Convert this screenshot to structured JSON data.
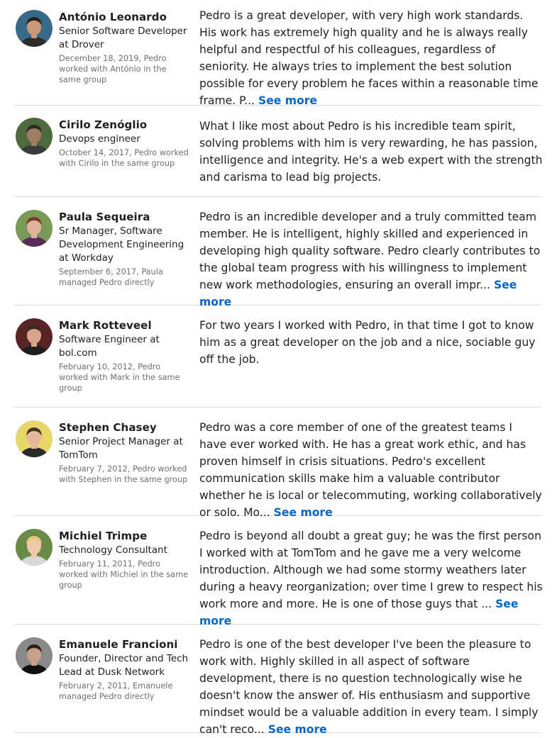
{
  "recommendations": [
    {
      "name": "António Leonardo",
      "title": "Senior Software Developer at Drover",
      "date": "December 18, 2019, Pedro worked with António in the same group",
      "text": "Pedro is a great developer, with very high work standards. His work has extremely high quality and he is always really helpful and respectful of his colleagues, regardless of seniority. He always tries to implement the best solution possible for every problem he faces within a reasonable time frame. P...",
      "see_more": "See more",
      "avatar": {
        "bg": "#3a6a8a",
        "skin": "#c99a7a",
        "hair": "#2a1e16",
        "shirt": "#2c2c2c"
      }
    },
    {
      "name": "Cirilo Zenóglio",
      "title": "Devops engineer",
      "date": "October 14, 2017, Pedro worked with Cirilo in the same group",
      "text": "What I like most about Pedro is his incredible team spirit, solving problems with him is very rewarding, he has passion, intelligence and integrity. He's a web expert with the strength and carisma to lead big projects.",
      "see_more": "",
      "avatar": {
        "bg": "#4f6b3e",
        "skin": "#a07d62",
        "hair": "#2f2a22",
        "shirt": "#3b3b3b"
      }
    },
    {
      "name": "Paula Sequeira",
      "title": "Sr Manager, Software Development Engineering at Workday",
      "date": "September 6, 2017, Paula managed Pedro directly",
      "text": "Pedro is an incredible developer and a truly committed team member. He is intelligent, highly skilled and experienced in developing high quality software. Pedro clearly contributes to the global team progress with his willingness to implement new work methodologies, ensuring an overall impr...",
      "see_more": "See more",
      "avatar": {
        "bg": "#7a9a5a",
        "skin": "#e0b39a",
        "hair": "#7a3a22",
        "shirt": "#5a2a5a"
      }
    },
    {
      "name": "Mark Rotteveel",
      "title": "Software Engineer at bol.com",
      "date": "February 10, 2012, Pedro worked with Mark in the same group",
      "text": "For two years I worked with Pedro, in that time I got to know him as a great developer on the job and a nice, sociable guy off the job.",
      "see_more": "",
      "avatar": {
        "bg": "#5a2424",
        "skin": "#d9a58a",
        "hair": "#3a2a22",
        "shirt": "#1e1e1e"
      }
    },
    {
      "name": "Stephen Chasey",
      "title": "Senior Project Manager at TomTom",
      "date": "February 7, 2012, Pedro worked with Stephen in the same group",
      "text": "Pedro was a core member of one of the greatest teams I have ever worked with. He has a great work ethic, and has proven himself in crisis situations. Pedro's excellent communication skills make him a valuable contributor whether he is local or telecommuting, working collaboratively or solo. Mo...",
      "see_more": "See more",
      "avatar": {
        "bg": "#e8d66a",
        "skin": "#e6b89a",
        "hair": "#4a3322",
        "shirt": "#2a2a2a"
      }
    },
    {
      "name": "Michiel Trimpe",
      "title": "Technology Consultant",
      "date": "February 11, 2011, Pedro worked with Michiel in the same group",
      "text": "Pedro is beyond all doubt a great guy; he was the first person I worked with at TomTom and he gave me a very welcome introduction. Although we had some stormy weathers later during a heavy reorganization; over time I grew to respect his work more and more. He is one of those guys that ...",
      "see_more": "See more",
      "avatar": {
        "bg": "#6a8a4a",
        "skin": "#f0c8aa",
        "hair": "#e6c878",
        "shirt": "#d8d8d8"
      }
    },
    {
      "name": "Emanuele Francioni",
      "title": "Founder, Director and Tech Lead at Dusk Network",
      "date": "February 2, 2011, Emanuele managed Pedro directly",
      "text": "Pedro is one of the best developer I've been the pleasure to work with. Highly skilled in all aspect of software development, there is no question technologically wise he doesn't know the answer of. His enthusiasm and supportive mindset would be a valuable addition in every team. I simply can't reco...",
      "see_more": "See more",
      "avatar": {
        "bg": "#8a8a8a",
        "skin": "#c8a08a",
        "hair": "#2a2018",
        "shirt": "#111111"
      }
    }
  ]
}
